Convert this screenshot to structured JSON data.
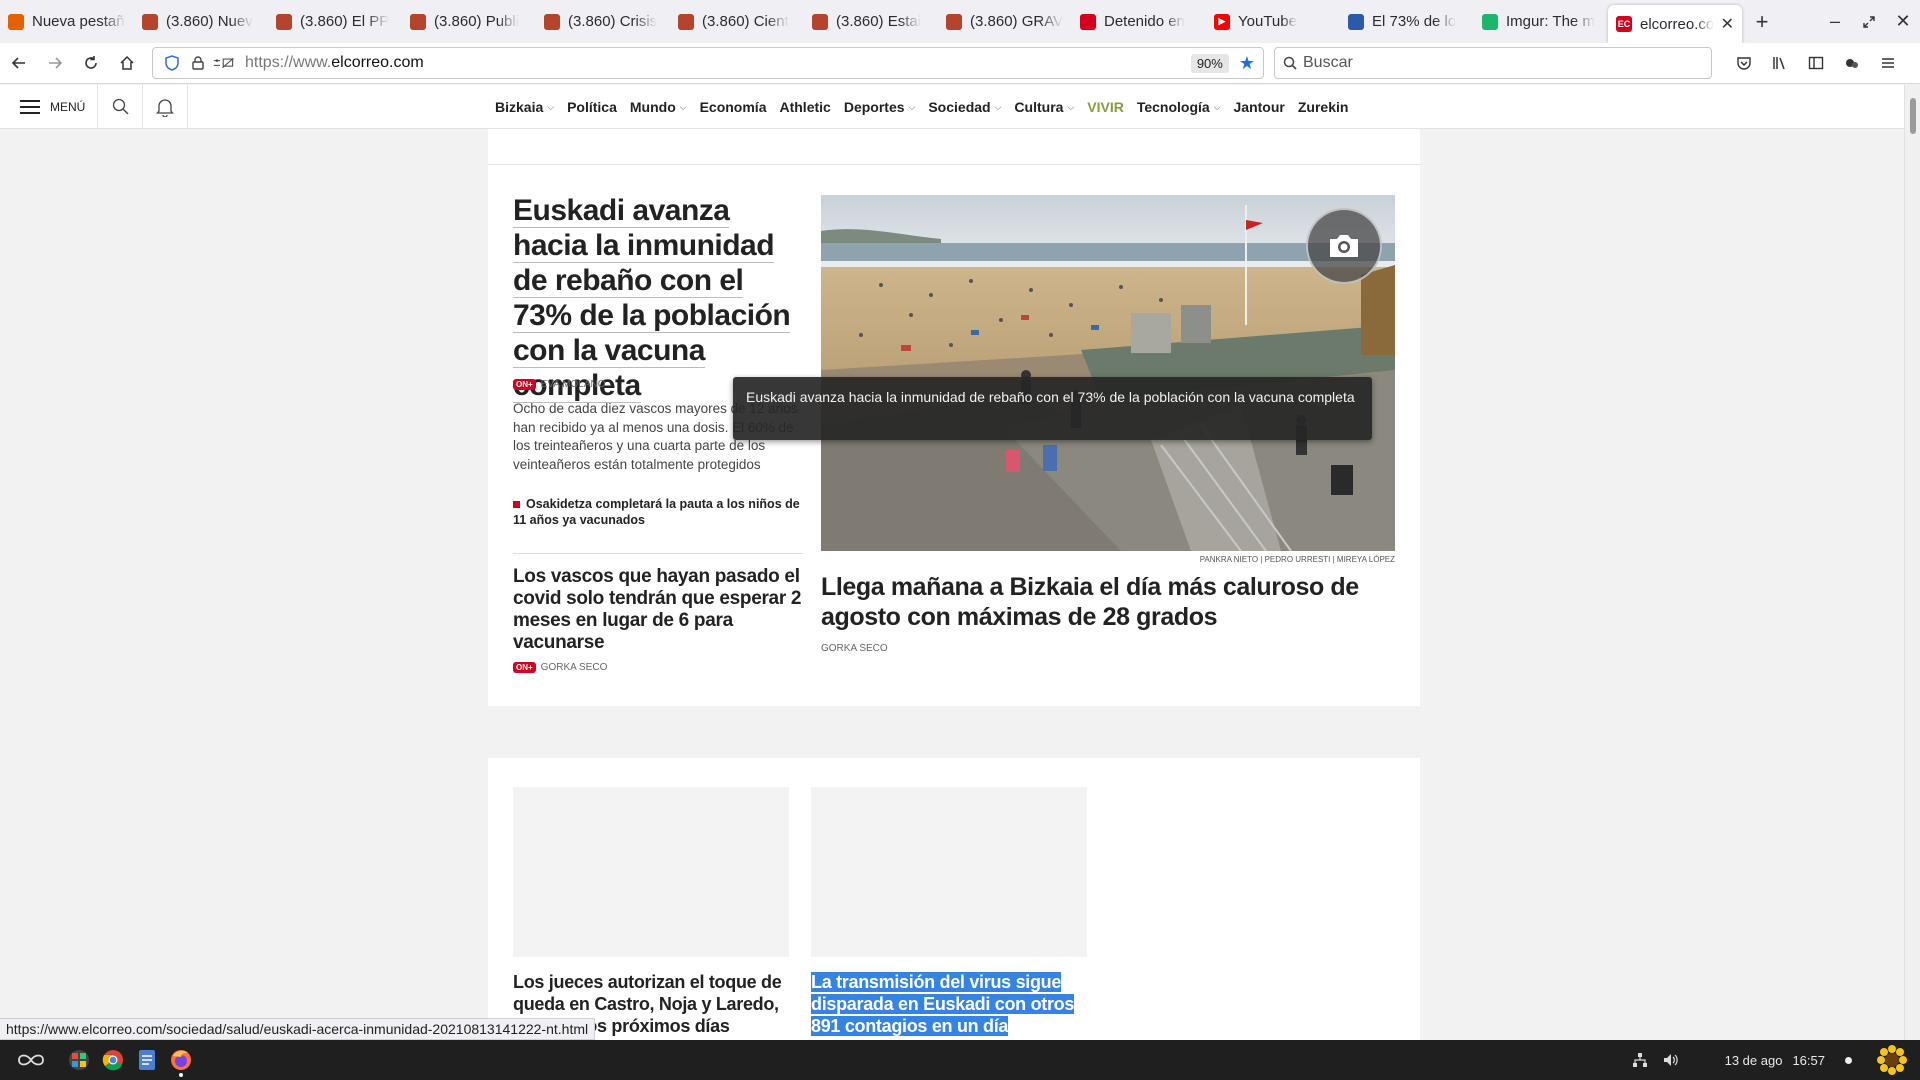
{
  "browser": {
    "tabs": [
      {
        "title": "Nueva pestaña",
        "icon": "firefox-icon",
        "color": "#e66000"
      },
      {
        "title": "(3.860) Nuev",
        "icon": "forum-icon",
        "color": "#b4442b"
      },
      {
        "title": "(3.860) El PP",
        "icon": "forum-icon",
        "color": "#b4442b"
      },
      {
        "title": "(3.860) Publi",
        "icon": "forum-icon",
        "color": "#b4442b"
      },
      {
        "title": "(3.860) Crisis",
        "icon": "forum-icon",
        "color": "#b4442b"
      },
      {
        "title": "(3.860) Cient",
        "icon": "forum-icon",
        "color": "#b4442b"
      },
      {
        "title": "(3.860) Estai",
        "icon": "forum-icon",
        "color": "#b4442b"
      },
      {
        "title": "(3.860) GRAV",
        "icon": "forum-icon",
        "color": "#b4442b"
      },
      {
        "title": "Detenido en",
        "icon": "news-icon",
        "color": "#d6001c"
      },
      {
        "title": "YouTube",
        "icon": "youtube-icon",
        "color": "#ff0000"
      },
      {
        "title": "El 73% de lo",
        "icon": "news-icon",
        "color": "#2a5aa8"
      },
      {
        "title": "Imgur: The m",
        "icon": "imgur-icon",
        "color": "#1bb76e"
      },
      {
        "title": "elcorreo.co",
        "icon": "elcorreo-icon",
        "color": "#d6001c",
        "active": true
      }
    ],
    "url_prefix": "https://www.",
    "url_domain": "elcorreo.com",
    "zoom": "90%",
    "search_placeholder": "Buscar",
    "status_url": "https://www.elcorreo.com/sociedad/salud/euskadi-acerca-inmunidad-20210813141222-nt.html"
  },
  "site": {
    "menu_label": "MENÚ",
    "sections": [
      {
        "label": "Bizkaia",
        "dropdown": true
      },
      {
        "label": "Política",
        "dropdown": false
      },
      {
        "label": "Mundo",
        "dropdown": true
      },
      {
        "label": "Economía",
        "dropdown": false
      },
      {
        "label": "Athletic",
        "dropdown": false
      },
      {
        "label": "Deportes",
        "dropdown": true
      },
      {
        "label": "Sociedad",
        "dropdown": true
      },
      {
        "label": "Cultura",
        "dropdown": true
      },
      {
        "label": "VIVIR",
        "dropdown": false,
        "color": "#8c9a3c"
      },
      {
        "label": "Tecnología",
        "dropdown": true
      },
      {
        "label": "Jantour",
        "dropdown": false
      },
      {
        "label": "Zurekin",
        "dropdown": false
      }
    ]
  },
  "lead": {
    "title": "Euskadi avanza hacia la inmunidad de rebaño con el 73% de la población con la vacuna completa",
    "badge": "on+",
    "author": "EVA MOLANO",
    "summary": "Ocho de cada diez vascos mayores de 12 años han recibido ya al menos una dosis. El 60% de los treinteañeros y una cuarta parte de los veinteañeros están totalmente protegidos",
    "related": "Osakidetza completará la pauta a los niños de 11 años ya vacunados"
  },
  "story2": {
    "title": "Los vascos que hayan pasado el covid solo tendrán que esperar 2 meses en lugar de 6 para vacunarse",
    "badge": "on+",
    "author": "GORKA SECO"
  },
  "hero": {
    "credit": "PANKRA NIETO | PEDRO URRESTI | MIREYA LÓPEZ"
  },
  "story3": {
    "title": "Llega mañana a Bizkaia el día más caluroso de agosto con máximas de 28 grados",
    "author": "GORKA SECO"
  },
  "tooltip": "Euskadi avanza hacia la inmunidad de rebaño con el 73% de la población con la vacuna completa",
  "row2": {
    "card1_title": "Los jueces autorizan el toque de queda en Castro, Noja y Laredo, durante los próximos días",
    "card2_title": "La transmisión del virus sigue disparada en Euskadi con otros 891 contagios en un día"
  },
  "taskbar": {
    "date": "13 de ago",
    "time": "16:57"
  },
  "colors": {
    "brand_red": "#d6001c",
    "selection": "#3584e4",
    "firefox_bar": "#f0f0f4"
  }
}
